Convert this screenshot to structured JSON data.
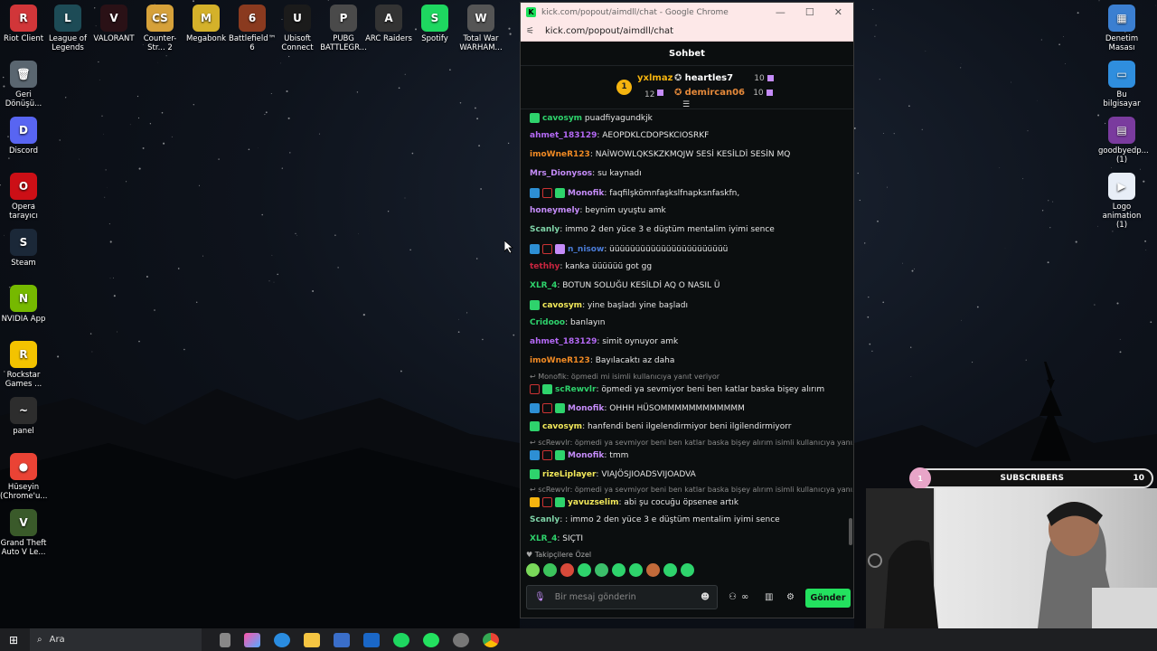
{
  "desktop_icons": [
    {
      "name": "riot-client-icon",
      "label": "Riot Client",
      "color": "#d13639",
      "glyph": "R"
    },
    {
      "name": "league-of-legends-icon",
      "label": "League of Legends",
      "color": "#1d4b56",
      "glyph": "L"
    },
    {
      "name": "valorant-icon",
      "label": "VALORANT",
      "color": "#2a1116",
      "glyph": "V"
    },
    {
      "name": "counter-strike-icon",
      "label": "Counter-Str... 2",
      "color": "#d6a13a",
      "glyph": "CS"
    },
    {
      "name": "megabonk-icon",
      "label": "Megabonk",
      "color": "#d4b12a",
      "glyph": "M"
    },
    {
      "name": "battlefield-icon",
      "label": "Battlefield™ 6",
      "color": "#8a3a1f",
      "glyph": "6"
    },
    {
      "name": "ubisoft-icon",
      "label": "Ubisoft Connect",
      "color": "#1b1b1b",
      "glyph": "U"
    },
    {
      "name": "pubg-icon",
      "label": "PUBG BATTLEGR...",
      "color": "#4a4a4a",
      "glyph": "P"
    },
    {
      "name": "arc-raiders-icon",
      "label": "ARC Raiders",
      "color": "#333333",
      "glyph": "A"
    },
    {
      "name": "spotify-icon",
      "label": "Spotify",
      "color": "#1ed760",
      "glyph": "S"
    },
    {
      "name": "total-war-icon",
      "label": "Total War WARHAM...",
      "color": "#555555",
      "glyph": "W"
    },
    {
      "name": "recycle-bin-icon",
      "label": "Geri Dönüşü...",
      "color": "#5a6670",
      "glyph": "🗑"
    },
    {
      "name": "discord-icon",
      "label": "Discord",
      "color": "#5865f2",
      "glyph": "D"
    },
    {
      "name": "opera-icon",
      "label": "Opera tarayıcı",
      "color": "#cc0f16",
      "glyph": "O"
    },
    {
      "name": "steam-icon",
      "label": "Steam",
      "color": "#1b2838",
      "glyph": "S"
    },
    {
      "name": "nvidia-icon",
      "label": "NVIDIA App",
      "color": "#76b900",
      "glyph": "N"
    },
    {
      "name": "rockstar-icon",
      "label": "Rockstar Games ...",
      "color": "#f3c300",
      "glyph": "R"
    },
    {
      "name": "panel-icon",
      "label": "panel",
      "color": "#2d2d2d",
      "glyph": "~"
    },
    {
      "name": "chrome-profile-icon",
      "label": "Hüseyin (Chrome'u...",
      "color": "#ea4335",
      "glyph": "●"
    },
    {
      "name": "gta5-icon",
      "label": "Grand Theft Auto V Le...",
      "color": "#3a5a2a",
      "glyph": "V"
    },
    {
      "name": "control-panel-icon",
      "label": "Denetim Masası",
      "color": "#3b7fd1",
      "glyph": "▦"
    },
    {
      "name": "this-pc-icon",
      "label": "Bu bilgisayar",
      "color": "#2f8ede",
      "glyph": "▭"
    },
    {
      "name": "winrar-icon",
      "label": "goodbyedp... (1)",
      "color": "#7a3b9e",
      "glyph": "▤"
    },
    {
      "name": "video-file-icon",
      "label": "Logo animation (1)",
      "color": "#e8eef7",
      "glyph": "▶"
    }
  ],
  "browser": {
    "title": "kick.com/popout/aimdll/chat - Google Chrome",
    "url": "kick.com/popout/aimdll/chat",
    "controls": [
      "—",
      "☐",
      "✕"
    ]
  },
  "chat": {
    "header": "Sohbet",
    "leaderboard": {
      "first": {
        "rank": "1",
        "name": "yxlmaz",
        "count": "12"
      },
      "second": {
        "name": "heartles7",
        "count": "10"
      },
      "third": {
        "name": "demircan06",
        "count": "10"
      }
    },
    "messages": [
      {
        "user": "cavosym",
        "color": "#2ed36c",
        "text": " puadfiyagundkjk",
        "badges": [
          "green"
        ]
      },
      {
        "user": "ahmet_183129",
        "color": "#b469f5",
        "text": ": AEOPDKLCDOPSKCIOSRKF",
        "badges": []
      },
      {
        "user": "imoWneR123",
        "color": "#f08a24",
        "text": ": NAİWOWLQKSKZKMQJW SESİ KESİLDİ SESİN MQ",
        "badges": []
      },
      {
        "user": "Mrs_Dionysos",
        "color": "#c58cf9",
        "text": ": su kaynadı",
        "badges": []
      },
      {
        "user": "Monofik",
        "color": "#c58cf9",
        "text": ": faqfilşkömnfaşkslfnapksnfaskfn,",
        "badges": [
          "blue",
          "red",
          "green"
        ]
      },
      {
        "user": "honeymely",
        "color": "#c58cf9",
        "text": ": beynim uyuştu amk",
        "badges": []
      },
      {
        "user": "Scanly",
        "color": "#7fd4a8",
        "text": ": immo 2 den yüce 3 e düştüm mentalim iyimi sence",
        "badges": []
      },
      {
        "user": "n_nisow",
        "color": "#4a7cd8",
        "text": ": üüüüüüüüüüüüüüüüüüüüüüü",
        "badges": [
          "blue",
          "red",
          "purple"
        ]
      },
      {
        "user": "tethhy",
        "color": "#c9253f",
        "text": ": kanka üüüüüü got gg",
        "badges": []
      },
      {
        "user": "XLR_4",
        "color": "#2ed36c",
        "text": ": BOTUN SOLUĞU KESİLDİ AQ O NASIL Ü",
        "badges": []
      },
      {
        "user": "cavosym",
        "color": "#f2e85a",
        "text": ": yine başladı yine başladı",
        "badges": [
          "green"
        ]
      },
      {
        "user": "Cridooo",
        "color": "#2ed36c",
        "text": ": banlayın",
        "badges": []
      },
      {
        "user": "ahmet_183129",
        "color": "#b469f5",
        "text": ": simit oynuyor amk",
        "badges": []
      },
      {
        "user": "imoWneR123",
        "color": "#f08a24",
        "text": ": Bayılacaktı az daha",
        "badges": []
      },
      {
        "reply": "Monofik: öpmedi mi isimli kullanıcıya yanıt veriyor"
      },
      {
        "user": "scRewvlr",
        "color": "#2ed36c",
        "text": ": öpmedi ya sevmiyor beni ben katlar baska bişey alırım",
        "badges": [
          "red",
          "green"
        ]
      },
      {
        "user": "Monofik",
        "color": "#c58cf9",
        "text": ": OHHH HÜSOMMMMMMMMMMMM",
        "badges": [
          "blue",
          "red",
          "green"
        ]
      },
      {
        "user": "cavosym",
        "color": "#f2e85a",
        "text": ": hanfendi beni ilgelendirmiyor beni ilgilendirmiyorr",
        "badges": [
          "green"
        ]
      },
      {
        "reply": "scRewvlr: öpmedi ya sevmiyor beni ben katlar baska bişey alırım isimli kullanıcıya yanı..."
      },
      {
        "user": "Monofik",
        "color": "#c58cf9",
        "text": ": tmm",
        "badges": [
          "blue",
          "red",
          "green"
        ]
      },
      {
        "user": "rizeLiplayer",
        "color": "#f2e85a",
        "text": ": VIAJÖSJIOADSVIJOADVA",
        "badges": [
          "green"
        ]
      },
      {
        "reply": "scRewvlr: öpmedi ya sevmiyor beni ben katlar baska bişey alırım isimli kullanıcıya yanı..."
      },
      {
        "user": "yavuzselim",
        "color": "#f2e85a",
        "text": ": abi şu cocuğu öpsenee artık",
        "badges": [
          "gold",
          "red",
          "green"
        ]
      },
      {
        "user": "Scanly",
        "color": "#7fd4a8",
        "text": ": : immo 2 den yüce 3 e düştüm mentalim iyimi sence",
        "badges": []
      },
      {
        "user": "XLR_4",
        "color": "#2ed36c",
        "text": ": SIÇTI",
        "badges": []
      }
    ],
    "emote_title": "Takipçilere Özel",
    "input_placeholder": "Bir mesaj gönderin",
    "send_label": "Gönder"
  },
  "subscribers": {
    "label": "SUBSCRIBERS",
    "current": "1",
    "goal": "10"
  },
  "taskbar": {
    "search_label": "Ara"
  },
  "colors": {
    "kick_green": "#23e15f",
    "accent_purple": "#c58cf9"
  }
}
